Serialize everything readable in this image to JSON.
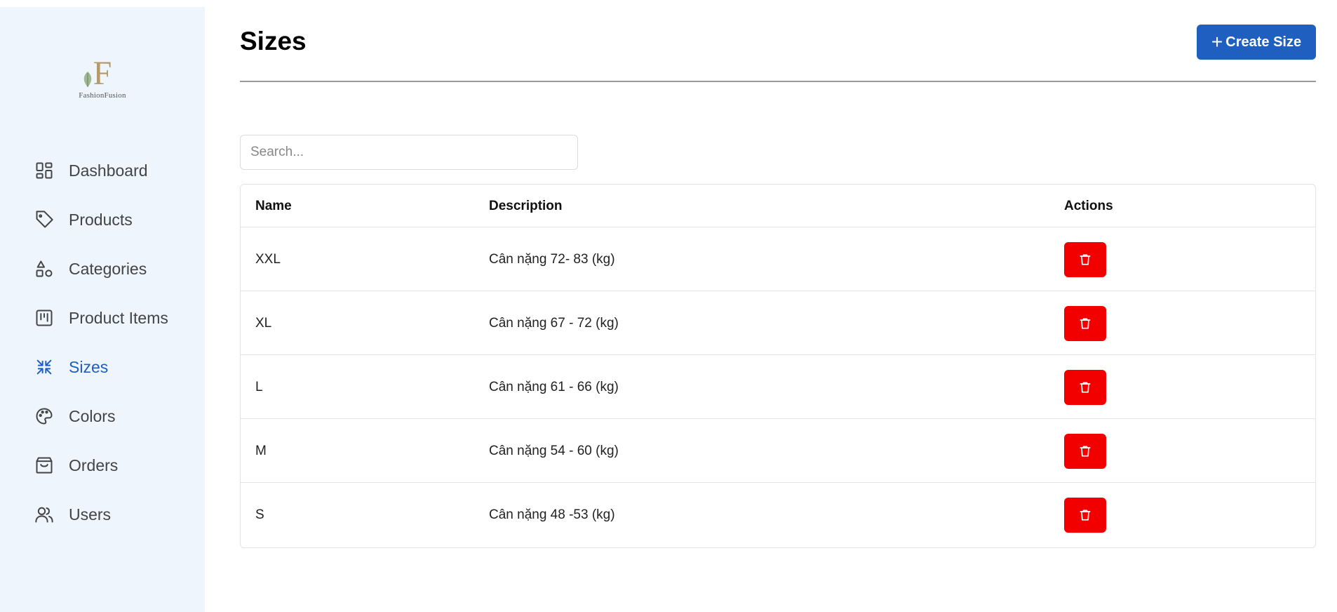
{
  "brand": {
    "logo_letter": "F",
    "logo_text": "FashionFusion"
  },
  "sidebar": {
    "items": [
      {
        "label": "Dashboard",
        "icon": "dashboard-icon",
        "active": false
      },
      {
        "label": "Products",
        "icon": "tag-icon",
        "active": false
      },
      {
        "label": "Categories",
        "icon": "shapes-icon",
        "active": false
      },
      {
        "label": "Product Items",
        "icon": "kanban-icon",
        "active": false
      },
      {
        "label": "Sizes",
        "icon": "shrink-icon",
        "active": true
      },
      {
        "label": "Colors",
        "icon": "palette-icon",
        "active": false
      },
      {
        "label": "Orders",
        "icon": "shopping-bag-icon",
        "active": false
      },
      {
        "label": "Users",
        "icon": "users-icon",
        "active": false
      }
    ]
  },
  "header": {
    "title": "Sizes",
    "create_label": "Create Size"
  },
  "search": {
    "placeholder": "Search...",
    "value": ""
  },
  "table": {
    "columns": [
      "Name",
      "Description",
      "Actions"
    ],
    "rows": [
      {
        "name": "XXL",
        "description": "Cân nặng 72- 83 (kg)"
      },
      {
        "name": "XL",
        "description": "Cân nặng 67 - 72 (kg)"
      },
      {
        "name": "L",
        "description": "Cân nặng 61 - 66 (kg)"
      },
      {
        "name": "M",
        "description": "Cân nặng 54 - 60 (kg)"
      },
      {
        "name": "S",
        "description": "Cân nặng 48 -53 (kg)"
      }
    ]
  },
  "colors": {
    "accent": "#1e5fc0",
    "danger": "#f20000",
    "sidebar_bg": "#eef5fd"
  }
}
